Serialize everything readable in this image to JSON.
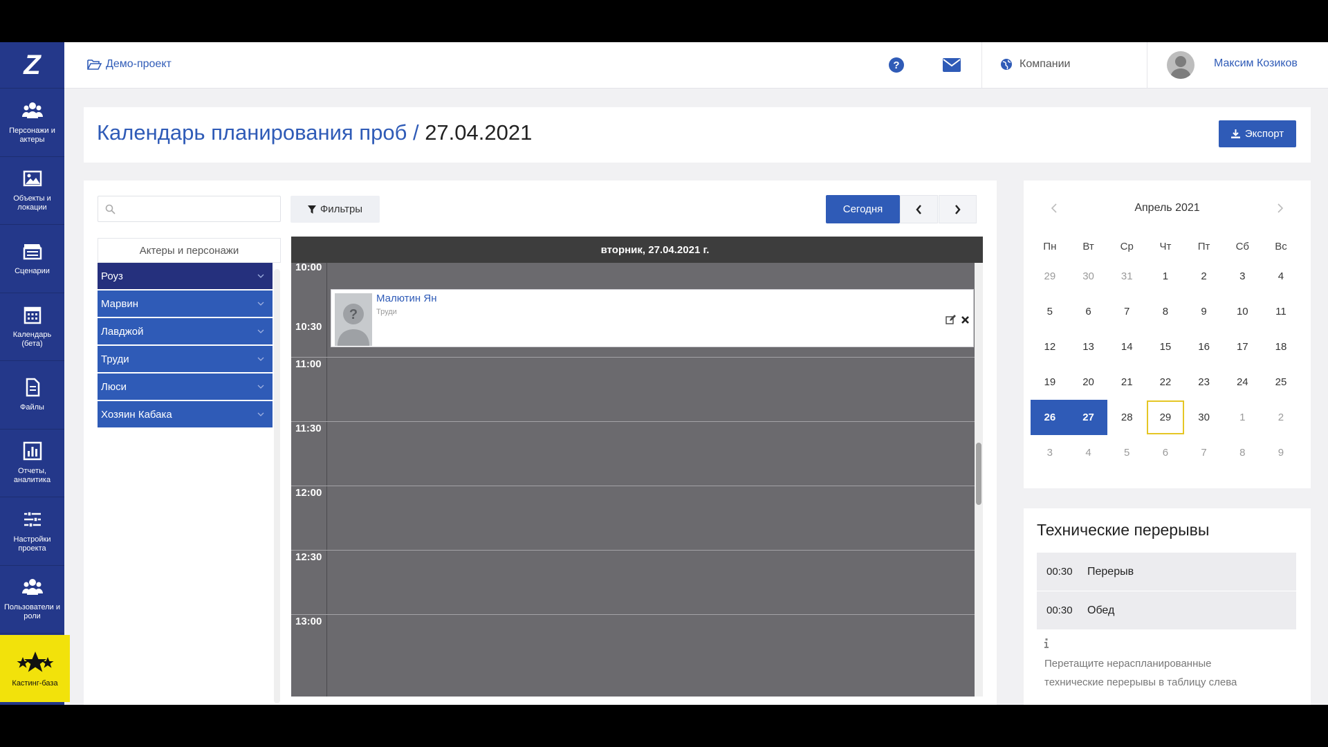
{
  "sidebar": {
    "logo": "Z",
    "items": [
      {
        "label": "Персонажи и актеры",
        "icon": "users-icon"
      },
      {
        "label": "Объекты и локации",
        "icon": "image-icon"
      },
      {
        "label": "Сценарии",
        "icon": "clapperboard-icon"
      },
      {
        "label": "Календарь (бета)",
        "icon": "calendar-icon"
      },
      {
        "label": "Файлы",
        "icon": "file-icon"
      },
      {
        "label": "Отчеты, аналитика",
        "icon": "bar-chart-icon"
      },
      {
        "label": "Настройки проекта",
        "icon": "sliders-icon"
      },
      {
        "label": "Пользователи и роли",
        "icon": "users-icon"
      }
    ],
    "casting": {
      "label": "Кастинг-база",
      "icon": "stars-icon"
    }
  },
  "topbar": {
    "project": "Демо-проект",
    "companies": "Компании",
    "user": "Максим Козиков"
  },
  "header": {
    "title_prefix": "Календарь планирования проб /",
    "title_date": "27.04.2021",
    "export_label": "Экспорт"
  },
  "toolbar": {
    "search_placeholder": "",
    "filters_label": "Фильтры",
    "today_label": "Сегодня"
  },
  "actors": {
    "header": "Актеры и персонажи",
    "items": [
      "Роуз",
      "Марвин",
      "Лавджой",
      "Труди",
      "Люси",
      "Хозяин Кабака"
    ]
  },
  "day_view": {
    "date_header": "вторник, 27.04.2021 г.",
    "times": [
      "10:00",
      "10:30",
      "11:00",
      "11:30",
      "12:00",
      "12:30",
      "13:00"
    ],
    "event": {
      "name": "Малютин Ян",
      "role": "Труди"
    }
  },
  "mini_calendar": {
    "month_label": "Апрель 2021",
    "weekdays": [
      "Пн",
      "Вт",
      "Ср",
      "Чт",
      "Пт",
      "Сб",
      "Вс"
    ],
    "weeks": [
      [
        "29",
        "30",
        "31",
        "1",
        "2",
        "3",
        "4"
      ],
      [
        "5",
        "6",
        "7",
        "8",
        "9",
        "10",
        "11"
      ],
      [
        "12",
        "13",
        "14",
        "15",
        "16",
        "17",
        "18"
      ],
      [
        "19",
        "20",
        "21",
        "22",
        "23",
        "24",
        "25"
      ],
      [
        "26",
        "27",
        "28",
        "29",
        "30",
        "1",
        "2"
      ],
      [
        "3",
        "4",
        "5",
        "6",
        "7",
        "8",
        "9"
      ]
    ],
    "selected": [
      "26",
      "27"
    ],
    "today": "29"
  },
  "tech_breaks": {
    "title": "Технические перерывы",
    "items": [
      {
        "time": "00:30",
        "name": "Перерыв"
      },
      {
        "time": "00:30",
        "name": "Обед"
      }
    ],
    "hint": "Перетащите нераспланированные технические перерывы в таблицу слева"
  },
  "colors": {
    "accent": "#2f5bb7",
    "sidebar": "#24388a",
    "casting": "#f2e20b",
    "today_outline": "#e5c624"
  }
}
